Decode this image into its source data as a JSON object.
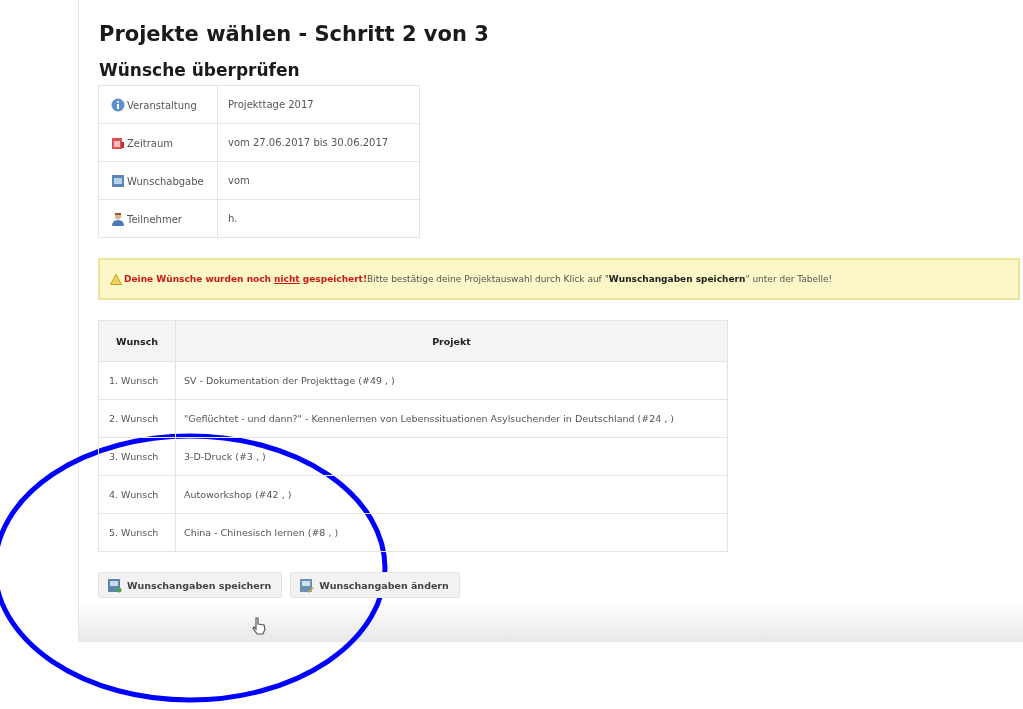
{
  "page": {
    "title": "Projekte wählen - Schritt 2 von 3",
    "subtitle": "Wünsche überprüfen"
  },
  "info": [
    {
      "kind": "info",
      "label": "Veranstaltung",
      "value": "Projekttage 2017"
    },
    {
      "kind": "calendar",
      "label": "Zeitraum",
      "value": "vom 27.06.2017 bis 30.06.2017"
    },
    {
      "kind": "form",
      "label": "Wunschabgabe",
      "value": "vom"
    },
    {
      "kind": "person",
      "label": "Teilnehmer",
      "value": "h."
    }
  ],
  "warning": {
    "lead": [
      {
        "text": "Deine Wünsche wurden noch",
        "underlined": false
      },
      {
        "text": "nicht",
        "underlined": true
      },
      {
        "text": "gespeichert!",
        "underlined": false
      }
    ],
    "text": "Bitte bestätige deine Projektauswahl durch Klick auf \"**Wunschangaben speichern**\" unter der Tabelle!"
  },
  "table": {
    "columns": [
      "Wunsch",
      "Projekt"
    ],
    "rows": [
      [
        "1. Wunsch",
        "SV - Dokumentation der Projekttage (#49 , )"
      ],
      [
        "2. Wunsch",
        "\"Geflüchtet - und dann?\" - Kennenlernen von Lebenssituationen Asylsuchender in Deutschland (#24 , )"
      ],
      [
        "3. Wunsch",
        "3-D-Druck (#3 , )"
      ],
      [
        "4. Wunsch",
        "Autoworkshop (#42 , )"
      ],
      [
        "5. Wunsch",
        "China - Chinesisch lernen (#8 , )"
      ]
    ]
  },
  "buttons": [
    {
      "kind": "save",
      "label": "Wunschangaben speichern"
    },
    {
      "kind": "edit",
      "label": "Wunschangaben ändern"
    }
  ]
}
